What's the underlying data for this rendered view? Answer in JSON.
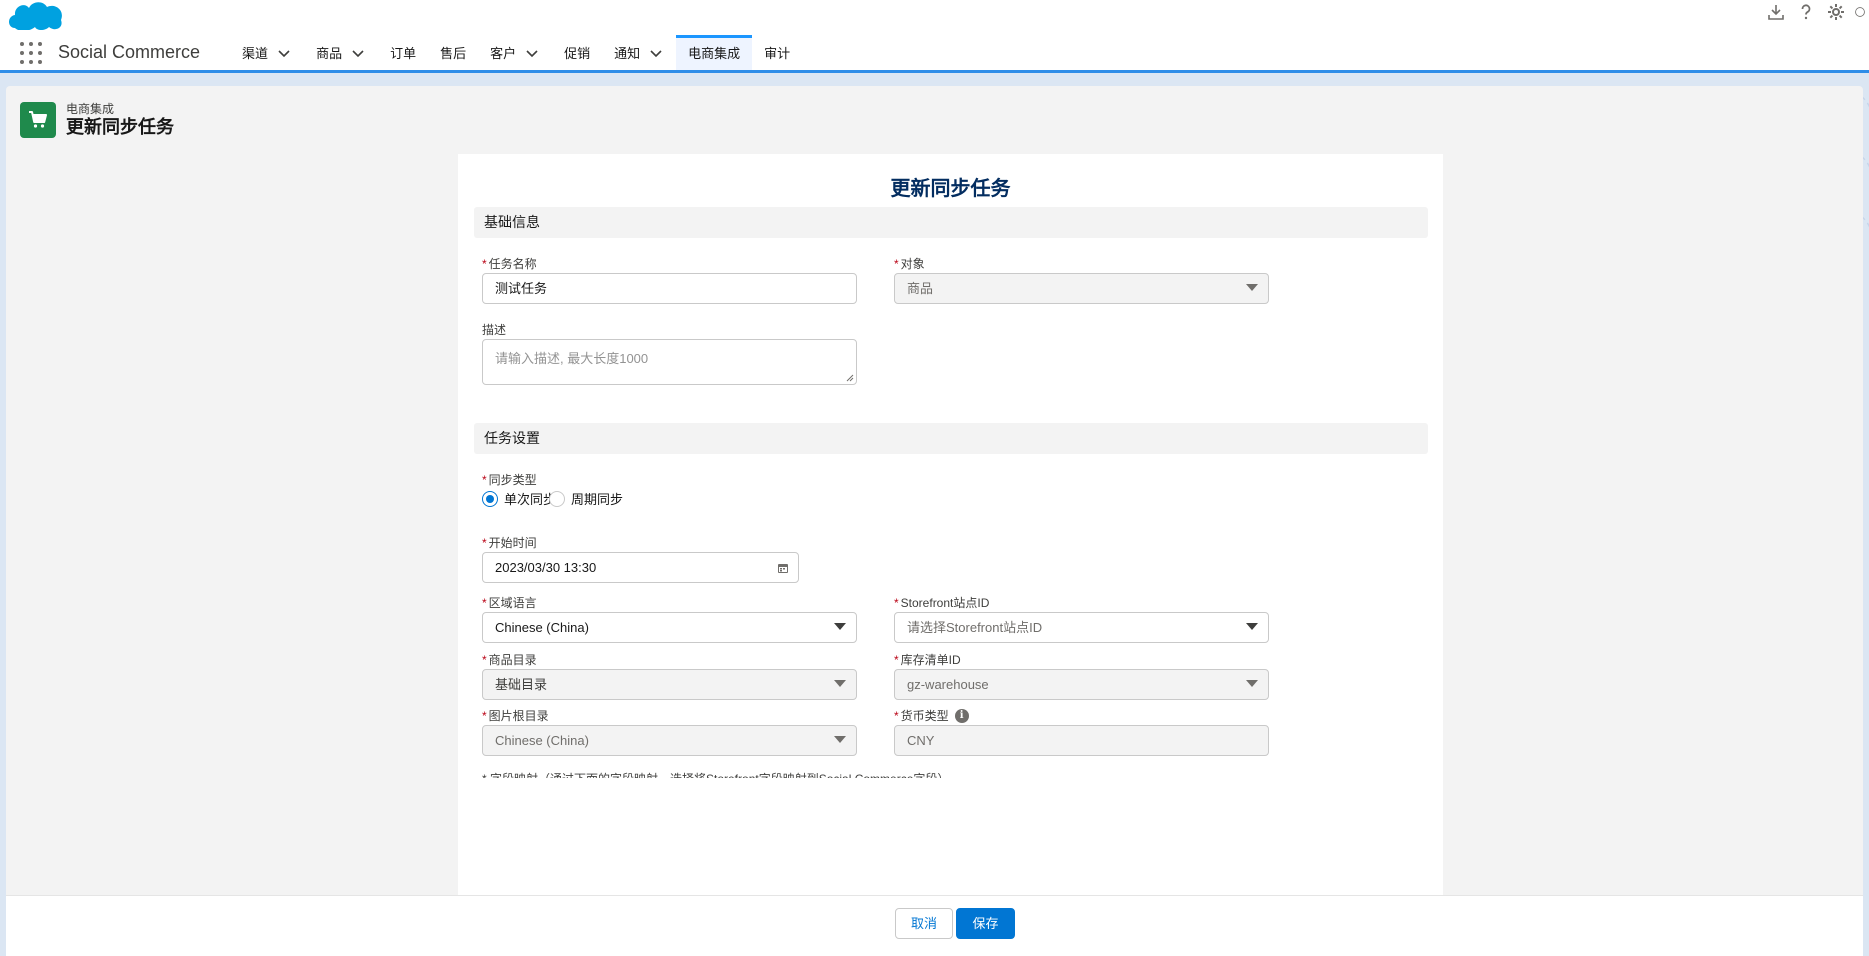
{
  "app": {
    "name": "Social Commerce",
    "nav": [
      {
        "label": "渠道",
        "dropdown": true,
        "active": false
      },
      {
        "label": "商品",
        "dropdown": true,
        "active": false
      },
      {
        "label": "订单",
        "dropdown": false,
        "active": false
      },
      {
        "label": "售后",
        "dropdown": false,
        "active": false
      },
      {
        "label": "客户",
        "dropdown": true,
        "active": false
      },
      {
        "label": "促销",
        "dropdown": false,
        "active": false
      },
      {
        "label": "通知",
        "dropdown": true,
        "active": false
      },
      {
        "label": "电商集成",
        "dropdown": false,
        "active": true
      },
      {
        "label": "审计",
        "dropdown": false,
        "active": false
      }
    ],
    "utility_icons": [
      "download-icon",
      "help-icon",
      "gear-icon"
    ]
  },
  "page": {
    "subtitle": "电商集成",
    "title": "更新同步任务",
    "icon": "cart-icon",
    "accent": "#1f8a4c"
  },
  "form": {
    "title": "更新同步任务",
    "sections": {
      "basic": "基础信息",
      "task": "任务设置"
    },
    "task_name": {
      "label": "任务名称",
      "required": true,
      "value": "测试任务"
    },
    "object": {
      "label": "对象",
      "required": true,
      "value": "商品"
    },
    "description": {
      "label": "描述",
      "placeholder": "请输入描述, 最大长度1000"
    },
    "sync_type": {
      "label": "同步类型",
      "required": true,
      "options": [
        {
          "label": "单次同步",
          "selected": true
        },
        {
          "label": "周期同步",
          "selected": false
        }
      ]
    },
    "start_time": {
      "label": "开始时间",
      "required": true,
      "value": "2023/03/30 13:30"
    },
    "locale": {
      "label": "区域语言",
      "required": true,
      "value": "Chinese (China)"
    },
    "storefront_id": {
      "label": "Storefront站点ID",
      "required": true,
      "placeholder": "请选择Storefront站点ID"
    },
    "catalog": {
      "label": "商品目录",
      "required": true,
      "value": "基础目录"
    },
    "inventory_id": {
      "label": "库存清单ID",
      "required": true,
      "value": "gz-warehouse"
    },
    "image_root": {
      "label": "图片根目录",
      "required": true,
      "value": "Chinese (China)"
    },
    "currency": {
      "label": "货币类型",
      "required": true,
      "value": "CNY"
    },
    "cut_off_text": "* 字段映射（通过下面的字段映射，选择将Storefront字段映射到Social Commerce字段）"
  },
  "footer": {
    "cancel": "取消",
    "save": "保存"
  }
}
